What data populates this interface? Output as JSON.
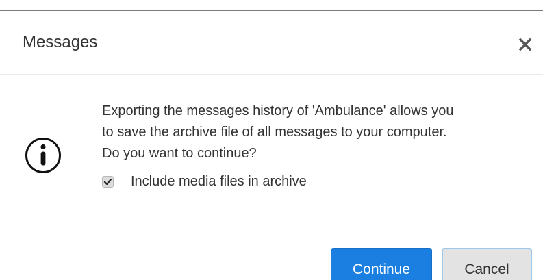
{
  "dialog": {
    "title": "Messages",
    "close_icon": "close-icon"
  },
  "body": {
    "icon": "info-icon",
    "message_lines": [
      "Exporting the messages history of 'Ambulance' allows you",
      "to save the archive file of all messages to your computer.",
      "Do you want to continue?"
    ],
    "checkbox": {
      "label": "Include media files in archive",
      "checked": true
    }
  },
  "footer": {
    "continue_label": "Continue",
    "cancel_label": "Cancel"
  },
  "colors": {
    "primary_button": "#1a7fe0",
    "secondary_button": "#e3e3e3",
    "focus_ring": "#9fc7ea",
    "text": "#333333"
  }
}
